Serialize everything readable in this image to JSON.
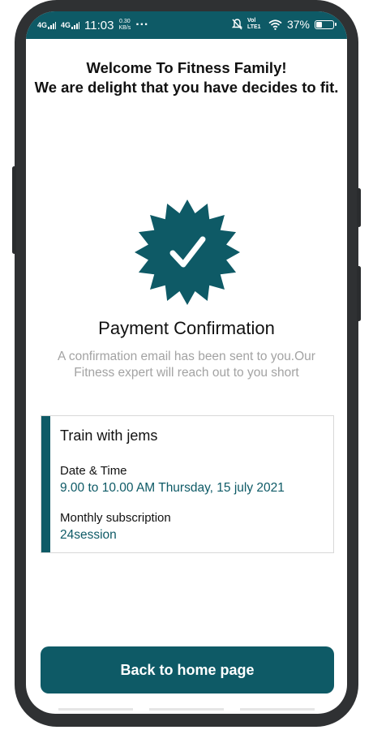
{
  "status_bar": {
    "network_1": "4G",
    "network_2": "4G",
    "time": "11:03",
    "speed_value": "0.30",
    "speed_unit": "KB/s",
    "more": "···",
    "volte": "Vol LTE1",
    "battery": "37%",
    "battery_level": 0.37
  },
  "welcome": {
    "line1": "Welcome To Fitness Family!",
    "line2": "We are delight that you have decides to fit."
  },
  "confirmation": {
    "icon": "verified-badge-check-icon",
    "title": "Payment Confirmation",
    "message": "A confirmation email has been sent to you.Our Fitness expert will reach out to you short"
  },
  "booking": {
    "title": "Train with jems",
    "datetime_label": "Date & Time",
    "datetime_value": "9.00 to 10.00 AM Thursday, 15 july 2021",
    "subscription_label": "Monthly subscription",
    "subscription_value": "24session"
  },
  "actions": {
    "back_label": "Back to home page"
  },
  "colors": {
    "primary": "#0e5a66",
    "muted_text": "#a3a3a3",
    "frame": "#2f3133"
  }
}
